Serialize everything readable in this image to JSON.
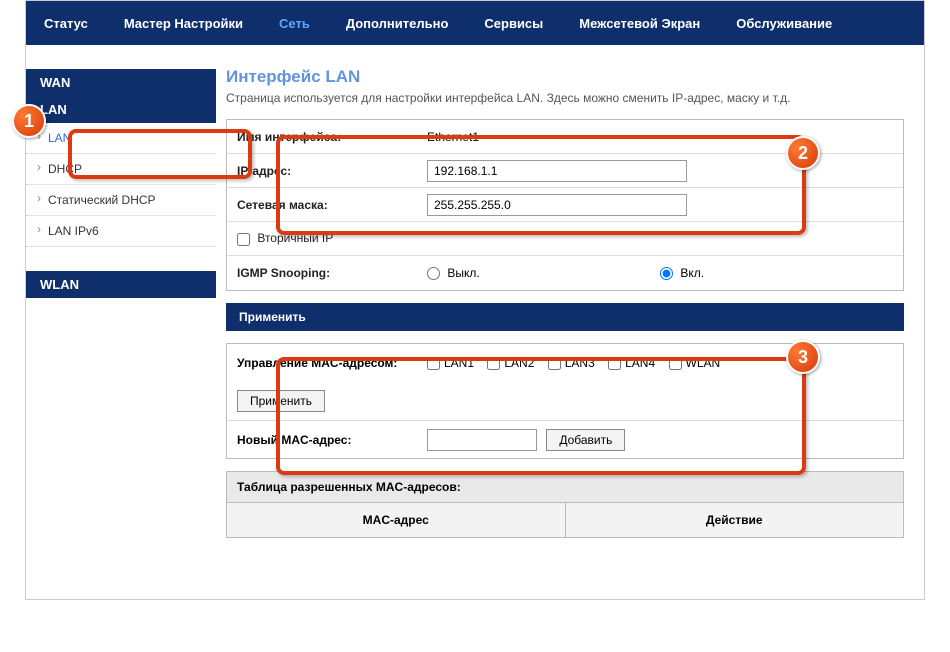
{
  "nav": [
    "Статус",
    "Мастер Настройки",
    "Сеть",
    "Дополнительно",
    "Сервисы",
    "Межсетевой Экран",
    "Обслуживание"
  ],
  "nav_active_index": 2,
  "sidebar": {
    "wan": "WAN",
    "lan": "LAN",
    "items": [
      "LAN",
      "DHCP",
      "Статический DHCP",
      "LAN IPv6"
    ],
    "active_index": 0,
    "wlan": "WLAN"
  },
  "page": {
    "title": "Интерфейс LAN",
    "desc": "Страница используется для настройки интерфейса LAN. Здесь можно сменить IP-адрес, маску и т.д."
  },
  "form": {
    "iface_label": "Имя интерфейса:",
    "iface_value": "Ethernet1",
    "ip_label": "IP-адрес:",
    "ip_value": "192.168.1.1",
    "mask_label": "Сетевая маска:",
    "mask_value": "255.255.255.0",
    "secip_label": "Вторичный IP",
    "igmp_label": "IGMP Snooping:",
    "igmp_off": "Выкл.",
    "igmp_on": "Вкл."
  },
  "apply": "Применить",
  "mac": {
    "mgmt_label": "Управление MAC-адресом:",
    "opts": [
      "LAN1",
      "LAN2",
      "LAN3",
      "LAN4",
      "WLAN"
    ],
    "apply": "Применить",
    "new_label": "Новый MAC-адрес:",
    "add": "Добавить"
  },
  "table": {
    "title": "Таблица разрешенных MAC-адресов:",
    "col_mac": "MAC-адрес",
    "col_action": "Действие"
  },
  "badges": [
    "1",
    "2",
    "3"
  ]
}
